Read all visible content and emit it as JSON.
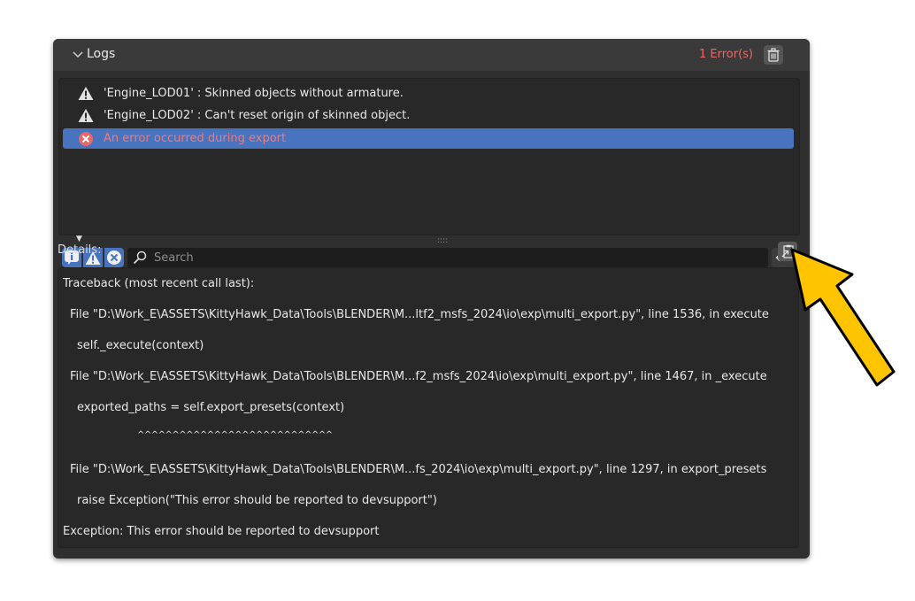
{
  "header": {
    "title": "Logs",
    "error_count": "1 Error(s)"
  },
  "logs": [
    {
      "type": "warning",
      "message": "'Engine_LOD01' : Skinned objects without armature."
    },
    {
      "type": "warning",
      "message": "'Engine_LOD02' : Can't reset origin of skinned object."
    },
    {
      "type": "error",
      "message": "An error occurred during export",
      "selected": true
    }
  ],
  "filters": {
    "search_placeholder": "Search",
    "buttons": [
      "info-filter",
      "warning-filter",
      "error-filter"
    ]
  },
  "details": {
    "label": "Details:",
    "lines": [
      "Traceback (most recent call last):",
      "File \"D:\\Work_E\\ASSETS\\KittyHawk_Data\\Tools\\BLENDER\\M...ltf2_msfs_2024\\io\\exp\\multi_export.py\", line 1536, in execute",
      "self._execute(context)",
      "File \"D:\\Work_E\\ASSETS\\KittyHawk_Data\\Tools\\BLENDER\\M...f2_msfs_2024\\io\\exp\\multi_export.py\", line 1467, in _execute",
      "exported_paths = self.export_presets(context)",
      "^^^^^^^^^^^^^^^^^^^^^^^^^^^^",
      "File \"D:\\Work_E\\ASSETS\\KittyHawk_Data\\Tools\\BLENDER\\M...fs_2024\\io\\exp\\multi_export.py\", line 1297, in export_presets",
      "raise Exception(\"This error should be reported to devsupport\")",
      "Exception: This error should be reported to devsupport"
    ]
  },
  "colors": {
    "panel": "#2f2f2f",
    "selected_row": "#4773bf",
    "error_text": "#e36a6a",
    "annotation_arrow": "#ffc400"
  }
}
